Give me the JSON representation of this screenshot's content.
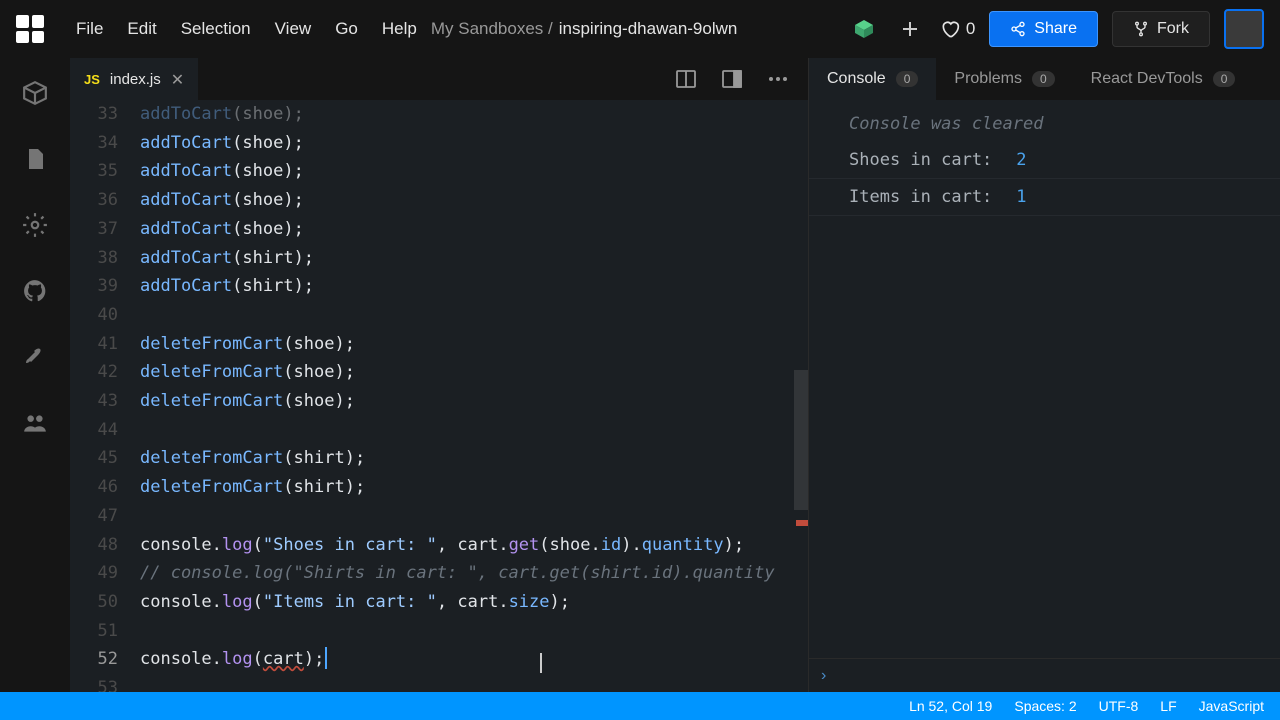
{
  "menu": {
    "file": "File",
    "edit": "Edit",
    "selection": "Selection",
    "view": "View",
    "go": "Go",
    "help": "Help"
  },
  "breadcrumb": {
    "prefix": "My Sandboxes /",
    "name": "inspiring-dhawan-9olwn"
  },
  "toolbar": {
    "heart_count": "0",
    "share": "Share",
    "fork": "Fork"
  },
  "tabs": {
    "file_icon": "JS",
    "file_name": "index.js"
  },
  "gutter": [
    "33",
    "34",
    "35",
    "36",
    "37",
    "38",
    "39",
    "40",
    "41",
    "42",
    "43",
    "44",
    "45",
    "46",
    "47",
    "48",
    "49",
    "50",
    "51",
    "52",
    "53"
  ],
  "code": {
    "l33": {
      "fn": "addToCart",
      "arg": "shoe",
      "end": ");"
    },
    "l34": {
      "fn": "addToCart",
      "arg": "shoe",
      "end": ");"
    },
    "l35": {
      "fn": "addToCart",
      "arg": "shoe",
      "end": ");"
    },
    "l36": {
      "fn": "addToCart",
      "arg": "shoe",
      "end": ");"
    },
    "l37": {
      "fn": "addToCart",
      "arg": "shoe",
      "end": ");"
    },
    "l38": {
      "fn": "addToCart",
      "arg": "shirt",
      "end": ");"
    },
    "l39": {
      "fn": "addToCart",
      "arg": "shirt",
      "end": ");"
    },
    "l41": {
      "fn": "deleteFromCart",
      "arg": "shoe",
      "end": ");"
    },
    "l42": {
      "fn": "deleteFromCart",
      "arg": "shoe",
      "end": ");"
    },
    "l43": {
      "fn": "deleteFromCart",
      "arg": "shoe",
      "end": ");"
    },
    "l45": {
      "fn": "deleteFromCart",
      "arg": "shirt",
      "end": ");"
    },
    "l46": {
      "fn": "deleteFromCart",
      "arg": "shirt",
      "end": ");"
    },
    "l48": {
      "obj": "console",
      "dot": ".",
      "method": "log",
      "open": "(",
      "str": "\"Shoes in cart: \"",
      "comma": ", ",
      "cart": "cart",
      "d2": ".",
      "get": "get",
      "o2": "(",
      "shoe": "shoe",
      "d3": ".",
      "id": "id",
      "c2": ")",
      "d4": ".",
      "qty": "quantity",
      "close": ");"
    },
    "l49": {
      "comment": "// console.log(\"Shirts in cart: \", cart.get(shirt.id).quantity"
    },
    "l50": {
      "obj": "console",
      "dot": ".",
      "method": "log",
      "open": "(",
      "str": "\"Items in cart: \"",
      "comma": ", ",
      "cart": "cart",
      "d2": ".",
      "size": "size",
      "close": ");"
    },
    "l52": {
      "obj": "console",
      "dot": ".",
      "method": "log",
      "open": "(",
      "arg": "cart",
      "close": ");"
    }
  },
  "console": {
    "tab_console": "Console",
    "tab_problems": "Problems",
    "tab_react": "React DevTools",
    "badge_console": "0",
    "badge_problems": "0",
    "badge_react": "0",
    "cleared": "Console was cleared",
    "line1_msg": "Shoes in cart:",
    "line1_val": "2",
    "line2_msg": "Items in cart:",
    "line2_val": "1"
  },
  "status": {
    "pos": "Ln 52, Col 19",
    "spaces": "Spaces: 2",
    "encoding": "UTF-8",
    "eol": "LF",
    "lang": "JavaScript"
  }
}
